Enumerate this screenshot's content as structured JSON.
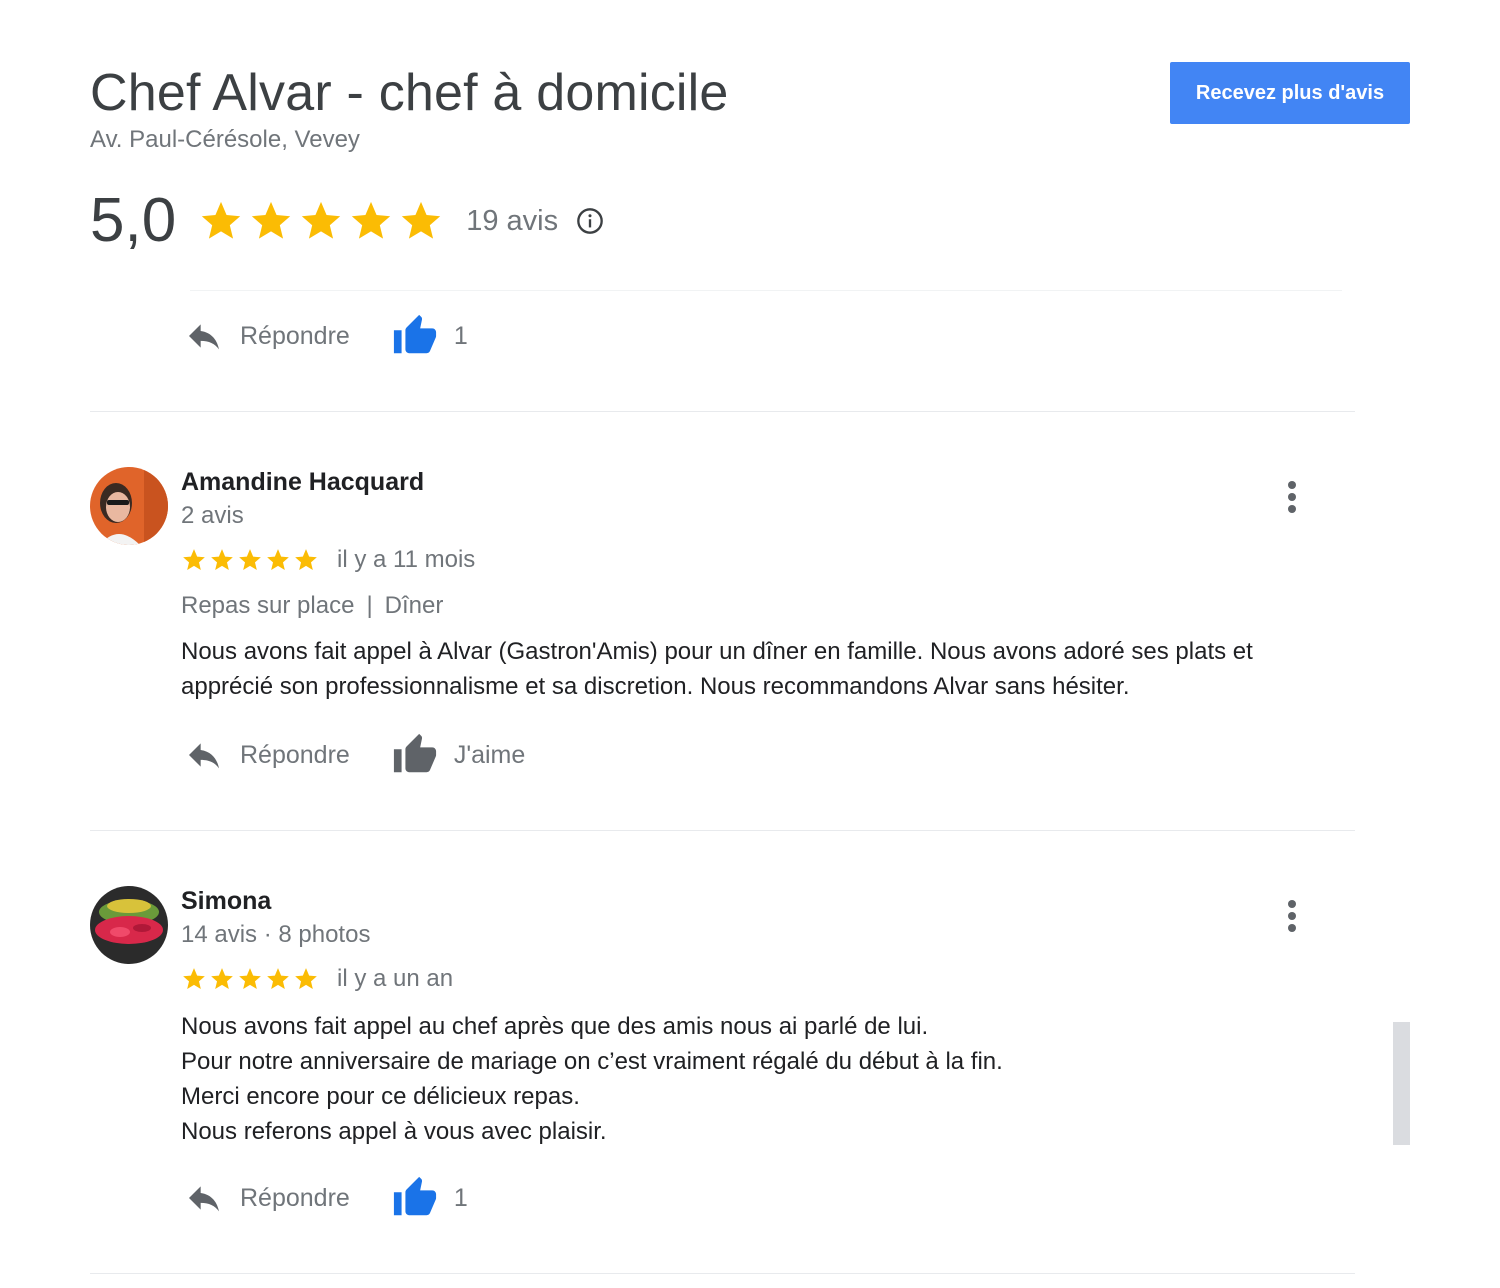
{
  "place": {
    "title": "Chef Alvar - chef à domicile",
    "address": "Av. Paul-Cérésole, Vevey"
  },
  "cta_label": "Recevez plus d'avis",
  "summary": {
    "score": "5,0",
    "stars": 5,
    "count_label": "19 avis"
  },
  "top_actions": {
    "reply_label": "Répondre",
    "like_count": "1"
  },
  "reviews": [
    {
      "name": "Amandine Hacquard",
      "meta": "2 avis",
      "stars": 5,
      "time": "il y a 11 mois",
      "tag1": "Repas sur place",
      "tag_sep": "|",
      "tag2": "Dîner",
      "lines": [
        "Nous avons fait appel à Alvar (Gastron'Amis) pour un dîner en famille. Nous avons adoré ses plats et",
        "apprécié son professionnalisme et sa discretion. Nous recommandons Alvar sans hésiter."
      ],
      "reply_label": "Répondre",
      "like_label": "J'aime"
    },
    {
      "name": "Simona",
      "meta": "14 avis · 8 photos",
      "stars": 5,
      "time": "il y a un an",
      "lines": [
        "Nous avons fait appel au chef après que des amis nous ai parlé de lui.",
        "Pour notre anniversaire de mariage on c’est vraiment régalé du début à la fin.",
        "Merci encore pour ce délicieux repas.",
        "Nous referons appel à vous avec plaisir."
      ],
      "reply_label": "Répondre",
      "like_label": "1"
    }
  ],
  "colors": {
    "star": "#fbbc04",
    "accent_button": "#4285f4",
    "like_active": "#1a73e8",
    "like_inactive": "#5f6368",
    "secondary_text": "#70757a"
  },
  "icons": [
    "star-icon",
    "info-icon",
    "reply-icon",
    "thumbs-up-icon",
    "more-vert-icon"
  ]
}
